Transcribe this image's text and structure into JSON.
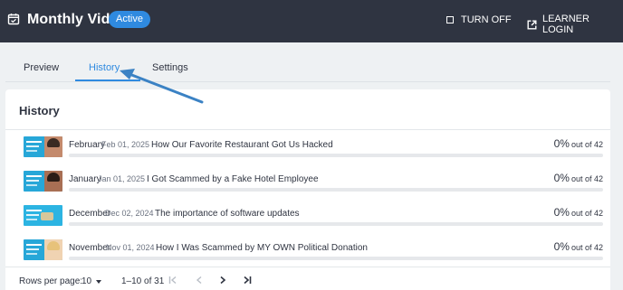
{
  "header": {
    "title": "Monthly Video",
    "status": "Active",
    "turn_off_label": "TURN OFF",
    "learner_login_label": "LEARNER LOGIN"
  },
  "tabs": [
    {
      "label": "Preview",
      "active": false
    },
    {
      "label": "History",
      "active": true
    },
    {
      "label": "Settings",
      "active": false
    }
  ],
  "history": {
    "title": "History",
    "rows": [
      {
        "month": "February",
        "date": "Feb 01, 2025",
        "title": "How Our Favorite Restaurant Got Us Hacked",
        "percent": "0%",
        "out_of": "out of 42",
        "progress": 0
      },
      {
        "month": "January",
        "date": "Jan 01, 2025",
        "title": "I Got Scammed by a Fake Hotel Employee",
        "percent": "0%",
        "out_of": "out of 42",
        "progress": 0
      },
      {
        "month": "December",
        "date": "Dec 02, 2024",
        "title": "The importance of software updates",
        "percent": "0%",
        "out_of": "out of 42",
        "progress": 0
      },
      {
        "month": "November",
        "date": "Nov 01, 2024",
        "title": "How I Was Scammed by MY OWN Political Donation",
        "percent": "0%",
        "out_of": "out of 42",
        "progress": 0
      }
    ]
  },
  "pagination": {
    "rows_per_page_label": "Rows per page:",
    "rows_per_page_value": "10",
    "range": "1–10 of 31"
  },
  "icons": {
    "header_left": "calendar-check-icon",
    "turn_off": "checkbox-icon",
    "learner_login": "open-external-icon",
    "first_page": "first-page-icon",
    "prev_page": "chevron-left-icon",
    "next_page": "chevron-right-icon",
    "last_page": "last-page-icon"
  },
  "colors": {
    "header_bg": "#2f3441",
    "accent": "#2f8ae0",
    "page_bg": "#eef1f3"
  }
}
